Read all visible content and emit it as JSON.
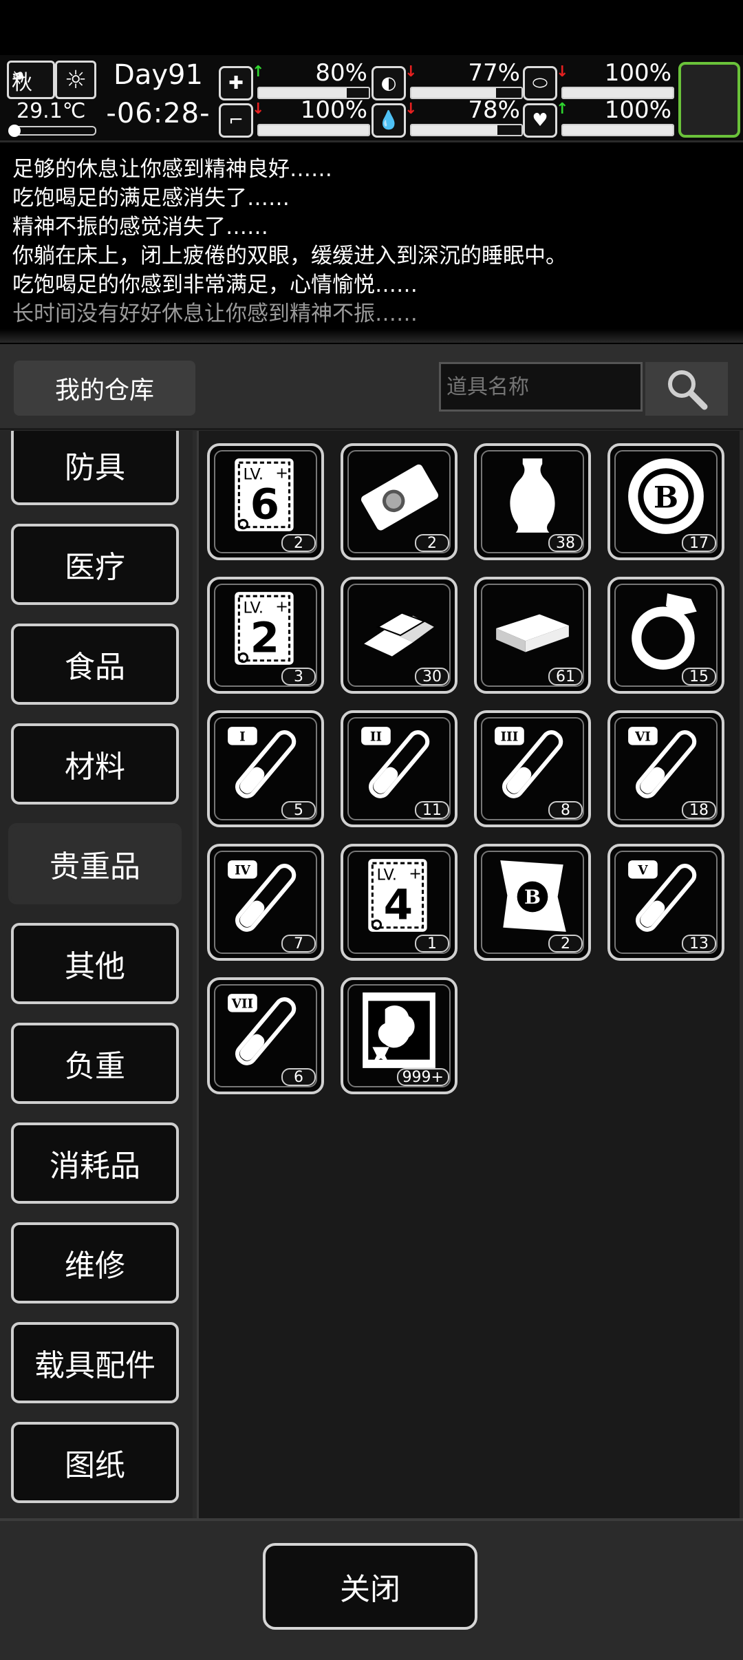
{
  "status": {
    "season": "秋",
    "weather": "sun-icon",
    "temperature": "29.1℃",
    "day": "Day91",
    "time": "-06:28-",
    "stats": [
      {
        "name": "health",
        "icon": "first-aid-icon",
        "trend": "up",
        "value": "80%",
        "level": 0.8
      },
      {
        "name": "hunger",
        "icon": "stomach-icon",
        "trend": "down",
        "value": "77%",
        "level": 0.77
      },
      {
        "name": "sanity",
        "icon": "capsule-icon",
        "trend": "down",
        "value": "100%",
        "level": 1.0
      },
      {
        "name": "stamina",
        "icon": "boot-icon",
        "trend": "down",
        "value": "100%",
        "level": 1.0
      },
      {
        "name": "thirst",
        "icon": "water-drop-icon",
        "trend": "down",
        "value": "78%",
        "level": 0.78
      },
      {
        "name": "mood",
        "icon": "heart-hand-icon",
        "trend": "up",
        "value": "100%",
        "level": 1.0
      }
    ]
  },
  "log": [
    "足够的休息让你感到精神良好……",
    "吃饱喝足的满足感消失了……",
    "精神不振的感觉消失了……",
    "你躺在床上，闭上疲倦的双眼，缓缓进入到深沉的睡眠中。",
    "吃饱喝足的你感到非常满足，心情愉悦……",
    "长时间没有好好休息让你感到精神不振……",
    "吃饱喝足的满足感消失了……"
  ],
  "warehouse": {
    "title": "我的仓库",
    "search_placeholder": "道具名称"
  },
  "categories": [
    "防具",
    "医疗",
    "食品",
    "材料",
    "贵重品",
    "其他",
    "负重",
    "消耗品",
    "维修",
    "载具配件",
    "图纸"
  ],
  "selected_category": "贵重品",
  "items": [
    {
      "icon": "skill-book-lv6-icon",
      "count": "2",
      "lv": "6"
    },
    {
      "icon": "lottery-ticket-icon",
      "count": "2"
    },
    {
      "icon": "vase-icon",
      "count": "38"
    },
    {
      "icon": "casino-chip-icon",
      "count": "17"
    },
    {
      "icon": "skill-book-lv2-icon",
      "count": "3",
      "lv": "2"
    },
    {
      "icon": "gold-bars-icon",
      "count": "30"
    },
    {
      "icon": "cash-stack-icon",
      "count": "61"
    },
    {
      "icon": "diamond-ring-icon",
      "count": "15"
    },
    {
      "icon": "test-tube-i-icon",
      "count": "5",
      "numeral": "I"
    },
    {
      "icon": "test-tube-ii-icon",
      "count": "11",
      "numeral": "II"
    },
    {
      "icon": "test-tube-iii-icon",
      "count": "8",
      "numeral": "III"
    },
    {
      "icon": "test-tube-vi-icon",
      "count": "18",
      "numeral": "VI"
    },
    {
      "icon": "test-tube-iv-icon",
      "count": "7",
      "numeral": "IV"
    },
    {
      "icon": "skill-book-lv4-icon",
      "count": "1",
      "lv": "4"
    },
    {
      "icon": "bitcoin-map-icon",
      "count": "2"
    },
    {
      "icon": "test-tube-v-icon",
      "count": "13",
      "numeral": "V"
    },
    {
      "icon": "test-tube-vii-icon",
      "count": "6",
      "numeral": "VII"
    },
    {
      "icon": "film-card-icon",
      "count": "999+"
    }
  ],
  "close_label": "关闭"
}
